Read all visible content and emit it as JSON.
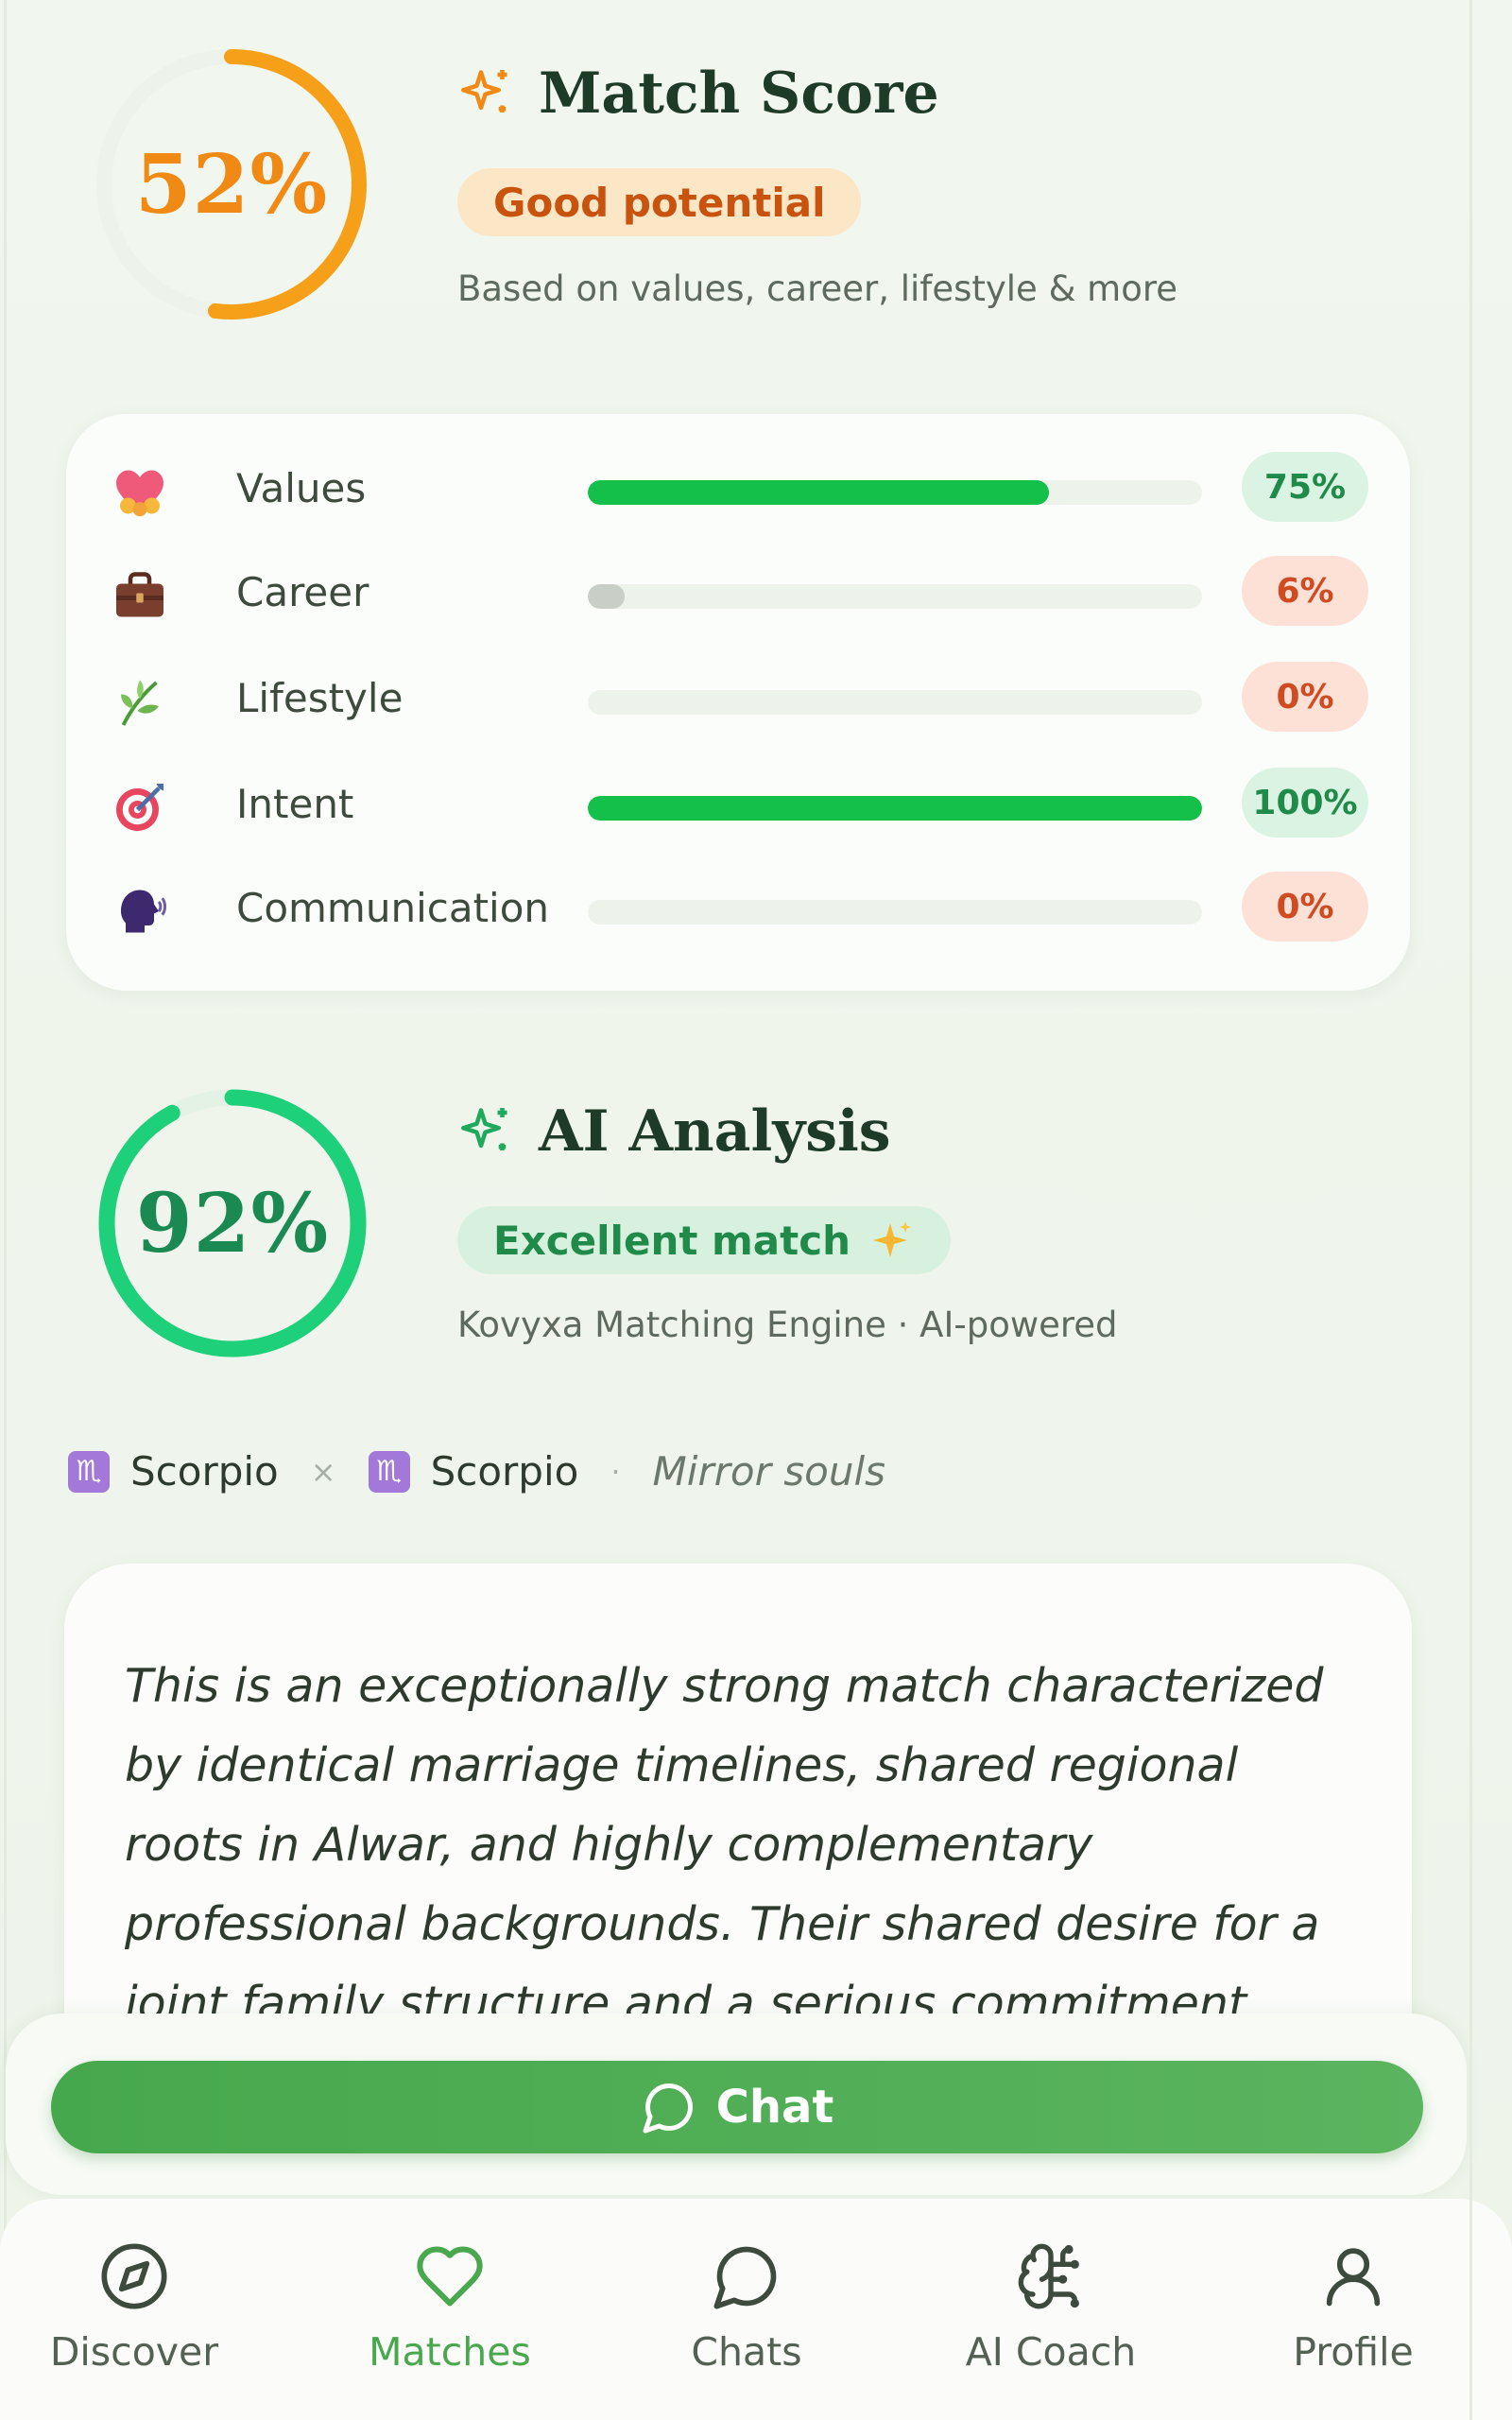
{
  "match_score": {
    "percent_label": "52%",
    "percent_value": 52,
    "title": "Match Score",
    "badge": "Good potential",
    "subtitle": "Based on values, career, lifestyle & more",
    "ring_color": "#f6a01a"
  },
  "breakdown": [
    {
      "label": "Values",
      "icon": "heart-icon",
      "percent": 75,
      "badge": "75%",
      "fill_color": "#14c04a",
      "badge_bg": "#daf3e2",
      "badge_color": "#1f8a4a"
    },
    {
      "label": "Career",
      "icon": "briefcase-icon",
      "percent": 6,
      "badge": "6%",
      "fill_color": "#c9cfc6",
      "badge_bg": "#fde1d7",
      "badge_color": "#cf4b22"
    },
    {
      "label": "Lifestyle",
      "icon": "herb-icon",
      "percent": 0,
      "badge": "0%",
      "fill_color": "#c9cfc6",
      "badge_bg": "#fde1d7",
      "badge_color": "#cf4b22"
    },
    {
      "label": "Intent",
      "icon": "target-icon",
      "percent": 100,
      "badge": "100%",
      "fill_color": "#14c04a",
      "badge_bg": "#daf3e2",
      "badge_color": "#1f8a4a"
    },
    {
      "label": "Communication",
      "icon": "speaking-head-icon",
      "percent": 0,
      "badge": "0%",
      "fill_color": "#c9cfc6",
      "badge_bg": "#fde1d7",
      "badge_color": "#cf4b22"
    }
  ],
  "ai_analysis": {
    "percent_label": "92%",
    "percent_value": 92,
    "title": "AI Analysis",
    "badge": "Excellent match",
    "subtitle": "Kovyxa Matching Engine · AI-powered",
    "ring_color": "#1fd07a"
  },
  "zodiac": {
    "sign_a": "Scorpio",
    "sign_b": "Scorpio",
    "symbol": "♏",
    "separator": "×",
    "dot": "·",
    "relation": "Mirror souls"
  },
  "analysis_text": "This is an exceptionally strong match characterized by identical marriage timelines, shared regional roots in Alwar, and highly complementary professional backgrounds. Their shared desire for a joint family structure and a serious commitment within a year",
  "chat_button": {
    "label": "Chat"
  },
  "nav": [
    {
      "label": "Discover",
      "icon": "compass-icon",
      "active": false
    },
    {
      "label": "Matches",
      "icon": "heart-outline-icon",
      "active": true
    },
    {
      "label": "Chats",
      "icon": "chat-bubble-icon",
      "active": false
    },
    {
      "label": "AI Coach",
      "icon": "brain-icon",
      "active": false
    },
    {
      "label": "Profile",
      "icon": "person-icon",
      "active": false
    }
  ]
}
